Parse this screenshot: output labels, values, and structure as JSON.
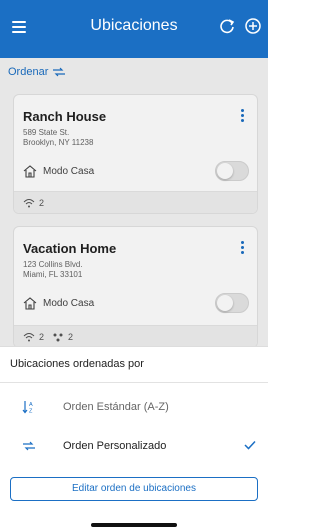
{
  "header": {
    "title": "Ubicaciones",
    "menu_icon": "hamburger-menu-icon",
    "refresh_icon": "refresh-icon",
    "add_icon": "add-circle-icon",
    "bg_color": "#1b6fc4"
  },
  "sort": {
    "label": "Ordenar",
    "icon": "reorder-arrows-icon"
  },
  "locations": [
    {
      "name": "Ranch House",
      "address_line1": "589 State St.",
      "address_line2": "Brooklyn, NY 11238",
      "mode_label": "Modo Casa",
      "mode_on": false,
      "wifi_count": "2"
    },
    {
      "name": "Vacation Home",
      "address_line1": "123 Collins Blvd.",
      "address_line2": "Miami, FL 33101",
      "mode_label": "Modo Casa",
      "mode_on": false,
      "wifi_count": "2",
      "device_count": "2"
    }
  ],
  "sheet": {
    "title": "Ubicaciones ordenadas por",
    "options": [
      {
        "label": "Orden Estándar (A-Z)",
        "icon": "sort-az-icon",
        "selected": false
      },
      {
        "label": "Orden Personalizado",
        "icon": "reorder-arrows-icon",
        "selected": true
      }
    ],
    "edit_button": "Editar orden de ubicaciones"
  }
}
